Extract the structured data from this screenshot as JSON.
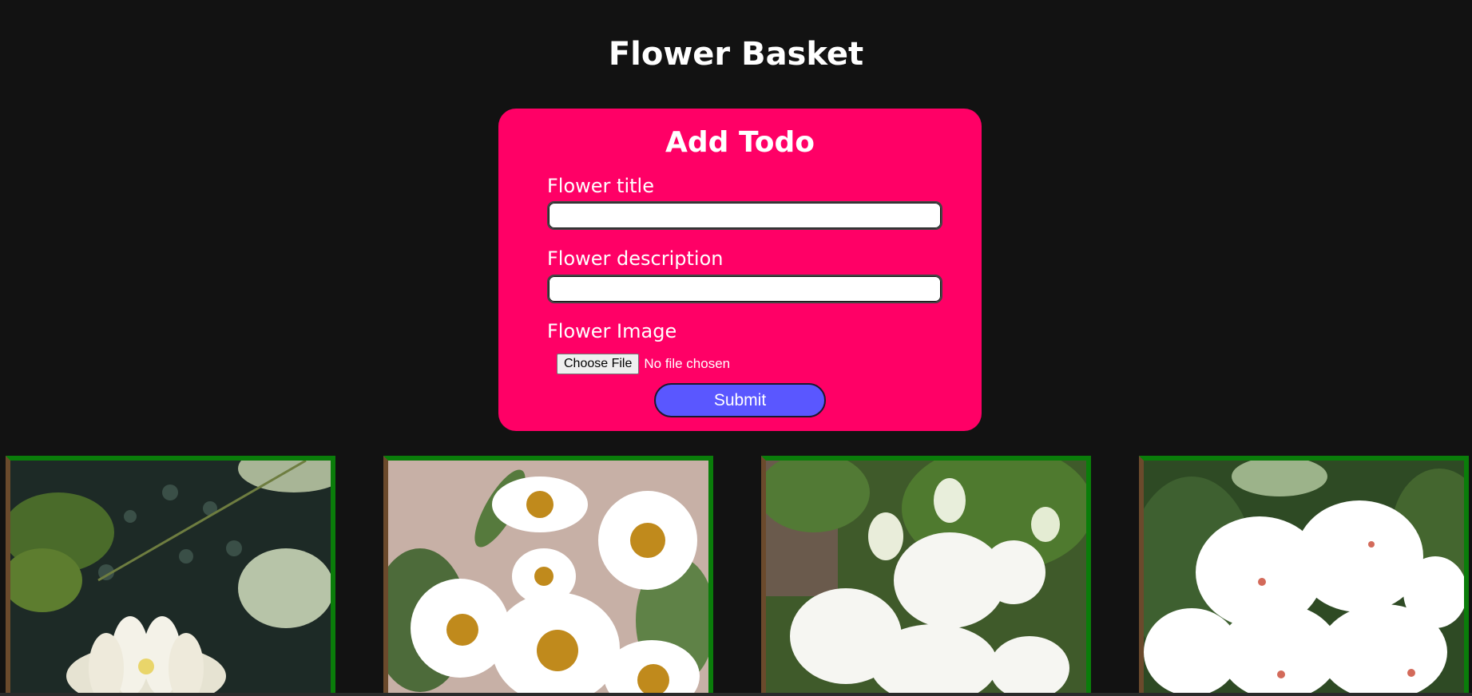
{
  "header": {
    "title": "Flower Basket"
  },
  "form": {
    "heading": "Add Todo",
    "title_label": "Flower title",
    "title_value": "",
    "description_label": "Flower description",
    "description_value": "",
    "image_label": "Flower Image",
    "file_button_label": "Choose File",
    "file_status": "No file chosen",
    "submit_label": "Submit"
  },
  "colors": {
    "background": "#121212",
    "card": "#ff0066",
    "submit": "#5a57ff",
    "frame_green": "#0a7d0a",
    "frame_brown": "#6b4a2c"
  },
  "gallery": {
    "items": [
      {
        "subject": "white water lily on pond"
      },
      {
        "subject": "white daisies"
      },
      {
        "subject": "white jasmine blossoms"
      },
      {
        "subject": "white geranium flowers"
      }
    ]
  }
}
